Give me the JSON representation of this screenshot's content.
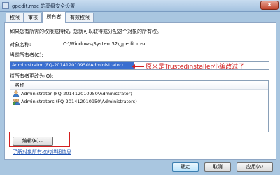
{
  "window": {
    "title": "gpedit.msc 的高级安全设置",
    "close_glyph": "x"
  },
  "tabs": [
    {
      "label": "权限"
    },
    {
      "label": "审核"
    },
    {
      "label": "所有者"
    },
    {
      "label": "有效权限"
    }
  ],
  "owner_tab": {
    "intro": "如果您有所需的权限或特权，您就可以取得或分配这个对象的所有权。",
    "object_name_label": "对象名称:",
    "object_name_value": "C:\\Windows\\System32\\gpedit.msc",
    "current_owner_label": "当前所有者(C):",
    "current_owner_value": "Administrator (FQ-201412010950\\Administrator)",
    "annotation": "原来是Trustedinstaller小编改过了",
    "change_owner_label": "将所有者更改为(O):",
    "list_header": "名称",
    "owners": [
      {
        "name": "Administrator (FQ-201412010950\\Administrator)"
      },
      {
        "name": "Administrators (FQ-201412010950\\Administrators)"
      }
    ],
    "edit_button": "编辑(E)...",
    "learn_more_link": "了解对象所有权的详细信息"
  },
  "footer": {
    "ok": "确定",
    "cancel": "取消",
    "apply": "应用(A)"
  },
  "colors": {
    "accent_selection": "#3a6fd0",
    "annotation_red": "#d32020",
    "link_blue": "#1a4fb0"
  }
}
